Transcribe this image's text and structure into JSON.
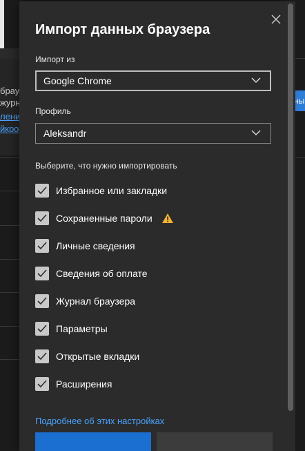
{
  "background": {
    "left_texts": [
      {
        "text": "брауз",
        "link": false
      },
      {
        "text": "журна",
        "link": false
      },
      {
        "text": "ления",
        "link": true
      },
      {
        "text": "йкро",
        "link": true
      }
    ],
    "right_button_label": "ны"
  },
  "dialog": {
    "title": "Импорт данных браузера",
    "import_from": {
      "label": "Импорт из",
      "value": "Google Chrome"
    },
    "profile": {
      "label": "Профиль",
      "value": "Aleksandr"
    },
    "choose_text": "Выберите, что нужно импортировать",
    "items": [
      {
        "label": "Избранное или закладки",
        "checked": true,
        "warning": false
      },
      {
        "label": "Сохраненные пароли",
        "checked": true,
        "warning": true
      },
      {
        "label": "Личные сведения",
        "checked": true,
        "warning": false
      },
      {
        "label": "Сведения об оплате",
        "checked": true,
        "warning": false
      },
      {
        "label": "Журнал браузера",
        "checked": true,
        "warning": false
      },
      {
        "label": "Параметры",
        "checked": true,
        "warning": false
      },
      {
        "label": "Открытые вкладки",
        "checked": true,
        "warning": false
      },
      {
        "label": "Расширения",
        "checked": true,
        "warning": false
      }
    ],
    "details_link": "Подробнее об этих настройках"
  },
  "colors": {
    "dialog_bg": "#2b2b2b",
    "accent": "#1a6fd0",
    "link": "#4aa3ff",
    "warning": "#f2b233",
    "checkbox": "#c8c8c8"
  }
}
